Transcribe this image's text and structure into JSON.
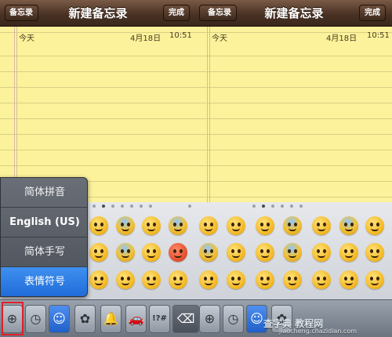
{
  "left_pane": {
    "back_label": "备忘录",
    "title": "新建备忘录",
    "done_label": "完成",
    "date_label": "今天",
    "date_day": "4月18日",
    "date_time": "10:51"
  },
  "right_pane": {
    "back_label": "备忘录",
    "title": "新建备忘录",
    "done_label": "完成",
    "date_label": "今天",
    "date_day": "4月18日",
    "date_time": "10:51"
  },
  "language_menu": {
    "items": [
      {
        "label": "简体拼音",
        "selected": false
      },
      {
        "label": "English (US)",
        "selected": false
      },
      {
        "label": "简体手写",
        "selected": false
      },
      {
        "label": "表情符号",
        "selected": true
      }
    ]
  },
  "keyboard_toolbar": {
    "left": [
      {
        "icon": "globe-icon",
        "glyph": "⊕"
      },
      {
        "icon": "clock-icon",
        "glyph": "◷"
      },
      {
        "icon": "smiley-icon",
        "glyph": "☺"
      },
      {
        "icon": "flower-icon",
        "glyph": "✿"
      },
      {
        "icon": "bell-icon",
        "glyph": "🔔"
      },
      {
        "icon": "car-icon",
        "glyph": "🚗"
      },
      {
        "icon": "symbols-icon",
        "glyph": "!?#"
      }
    ],
    "right": [
      {
        "icon": "delete-icon",
        "glyph": "⌫"
      },
      {
        "icon": "globe-icon",
        "glyph": "⊕"
      },
      {
        "icon": "clock-icon",
        "glyph": "◷"
      },
      {
        "icon": "smiley-icon",
        "glyph": "☺"
      },
      {
        "icon": "flower-icon",
        "glyph": "✿"
      }
    ]
  },
  "watermark": {
    "text": "查字典 教程网",
    "url": "jiaocheng.chazidian.com"
  },
  "colors": {
    "paper": "#fbf29b",
    "selected_accent": "#1f6bd8",
    "highlight_border": "#e0202a"
  }
}
